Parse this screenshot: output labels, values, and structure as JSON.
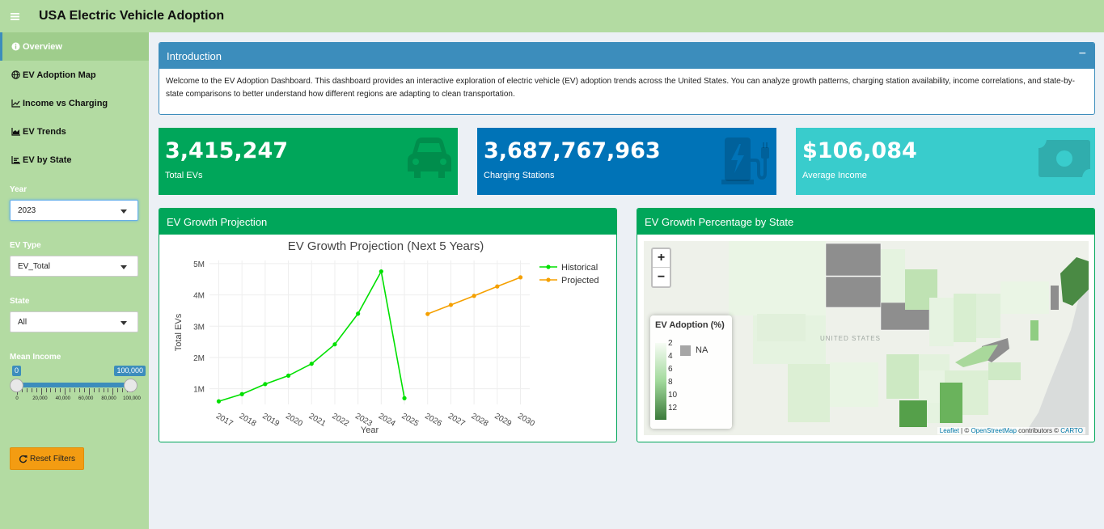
{
  "header": {
    "title": "USA Electric Vehicle Adoption"
  },
  "sidebar": {
    "nav": [
      {
        "label": "Overview",
        "icon": "info-circle-icon"
      },
      {
        "label": "EV Adoption Map",
        "icon": "globe-icon"
      },
      {
        "label": "Income vs Charging",
        "icon": "line-chart-icon"
      },
      {
        "label": "EV Trends",
        "icon": "area-chart-icon"
      },
      {
        "label": "EV by State",
        "icon": "bar-chart-icon"
      }
    ],
    "filters": {
      "year_label": "Year",
      "year_value": "2023",
      "evtype_label": "EV Type",
      "evtype_value": "EV_Total",
      "state_label": "State",
      "state_value": "All",
      "income_label": "Mean Income",
      "income_min": "0",
      "income_max": "100,000",
      "income_ticks": [
        "0",
        "20,000",
        "40,000",
        "60,000",
        "80,000",
        "100,000"
      ],
      "reset_label": "Reset Filters"
    }
  },
  "intro": {
    "title": "Introduction",
    "collapse": "−",
    "text": "Welcome to the EV Adoption Dashboard. This dashboard provides an interactive exploration of electric vehicle (EV) adoption trends across the United States. You can analyze growth patterns, charging station availability, income correlations, and state-by-state comparisons to better understand how different regions are adapting to clean transportation."
  },
  "value_boxes": [
    {
      "value": "3,415,247",
      "label": "Total EVs",
      "color": "#00a65a",
      "icon": "car-icon"
    },
    {
      "value": "3,687,767,963",
      "label": "Charging Stations",
      "color": "#0073b7",
      "icon": "charging-station-icon"
    },
    {
      "value": "$106,084",
      "label": "Average Income",
      "color": "#39cccc",
      "icon": "money-bill-icon"
    }
  ],
  "growth_box": {
    "title": "EV Growth Projection"
  },
  "map_box": {
    "title": "EV Growth Percentage by State",
    "zoom_in": "+",
    "zoom_out": "−",
    "map_label": "UNITED STATES",
    "legend_title": "EV Adoption (%)",
    "legend_ticks": [
      "2",
      "4",
      "6",
      "8",
      "10",
      "12"
    ],
    "legend_na": "NA",
    "attribution": {
      "leaflet": "Leaflet",
      "sep": " | © ",
      "osm": "OpenStreetMap",
      "mid": " contributors © ",
      "carto": "CARTO"
    }
  },
  "chart_data": {
    "type": "line",
    "title": "EV Growth Projection (Next 5 Years)",
    "xlabel": "Year",
    "ylabel": "Total EVs",
    "ytick_labels": [
      "1M",
      "2M",
      "3M",
      "4M",
      "5M"
    ],
    "ylim": [
      500000,
      5100000
    ],
    "xlim": [
      2016.6,
      2030.4
    ],
    "x_ticks": [
      2017,
      2018,
      2019,
      2020,
      2021,
      2022,
      2023,
      2024,
      2025,
      2026,
      2027,
      2028,
      2029,
      2030
    ],
    "legend_position": "top-right",
    "grid": true,
    "series": [
      {
        "name": "Historical",
        "color": "#00e000",
        "x": [
          2017,
          2018,
          2019,
          2020,
          2021,
          2022,
          2023,
          2024,
          2025
        ],
        "y": [
          600000,
          830000,
          1150000,
          1420000,
          1800000,
          2420000,
          3400000,
          4750000,
          700000
        ]
      },
      {
        "name": "Projected",
        "color": "#f5a000",
        "x": [
          2026,
          2027,
          2028,
          2029,
          2030
        ],
        "y": [
          3390000,
          3680000,
          3970000,
          4270000,
          4560000
        ]
      }
    ]
  }
}
